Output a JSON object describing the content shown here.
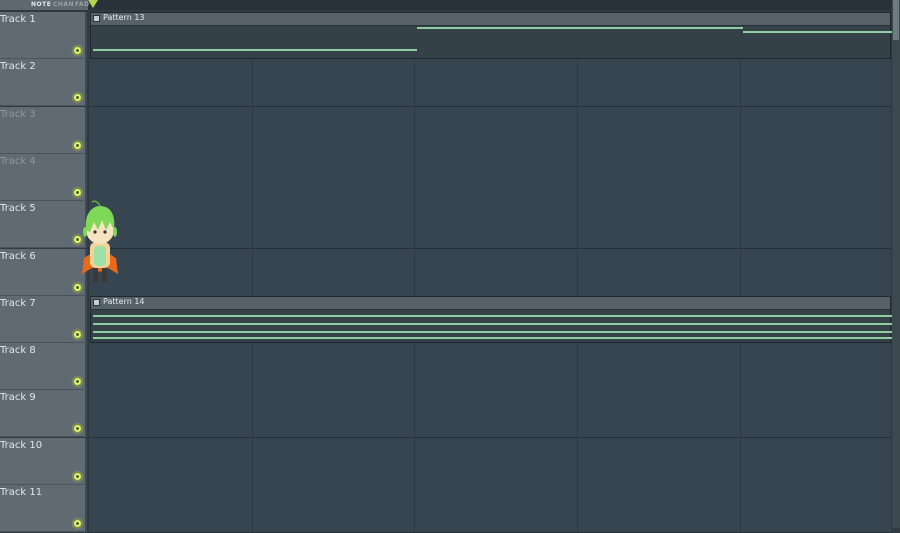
{
  "topbar": {
    "tabs": [
      "NOTE",
      "CHAN",
      "FAD"
    ]
  },
  "tracks": [
    {
      "label": "Track 1",
      "dim": false
    },
    {
      "label": "Track 2",
      "dim": false
    },
    {
      "label": "Track 3",
      "dim": true
    },
    {
      "label": "Track 4",
      "dim": true
    },
    {
      "label": "Track 5",
      "dim": false
    },
    {
      "label": "Track 6",
      "dim": false
    },
    {
      "label": "Track 7",
      "dim": false
    },
    {
      "label": "Track 8",
      "dim": false
    },
    {
      "label": "Track 9",
      "dim": false
    },
    {
      "label": "Track 10",
      "dim": false
    },
    {
      "label": "Track 11",
      "dim": false
    }
  ],
  "patterns": [
    {
      "name": "Pattern 13",
      "track": 1
    },
    {
      "name": "Pattern 14",
      "track": 7
    }
  ],
  "colors": {
    "led": "#e7f27a",
    "note": "#90cda0",
    "marker": "#b7d44a",
    "mascot_hair": "#7ed957",
    "mascot_cape": "#e86a1a"
  },
  "icons": [
    "timeline-marker-icon",
    "pattern-clip-icon",
    "track-led-icon",
    "mascot-icon"
  ]
}
